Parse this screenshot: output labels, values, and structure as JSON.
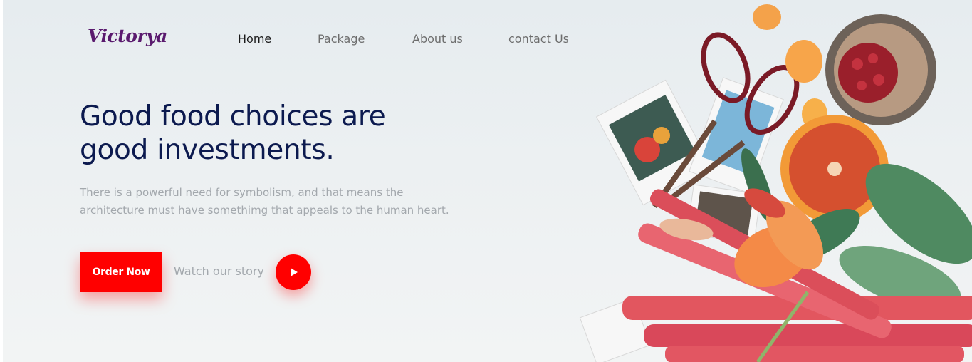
{
  "brand": {
    "name": "Victorya",
    "color": "#5a1a6e"
  },
  "nav": {
    "items": [
      {
        "label": "Home",
        "active": true
      },
      {
        "label": "Package",
        "active": false
      },
      {
        "label": "About us",
        "active": false
      },
      {
        "label": "contact Us",
        "active": false
      }
    ]
  },
  "hero": {
    "headline_line1": "Good food choices are",
    "headline_line2": "good investments.",
    "subtext_line1": "There is a powerful need for symbolism, and that means the",
    "subtext_line2": "architecture must have somethimg that appeals to the human heart.",
    "order_button": "Order Now",
    "watch_label": "Watch our story",
    "play_icon": "play-icon"
  },
  "image": {
    "description_icon": "food-flatlay-image"
  },
  "colors": {
    "accent": "#ff0000",
    "headline": "#0c1a4f",
    "muted": "#a3a8ad",
    "background": "#ecf0f2"
  }
}
